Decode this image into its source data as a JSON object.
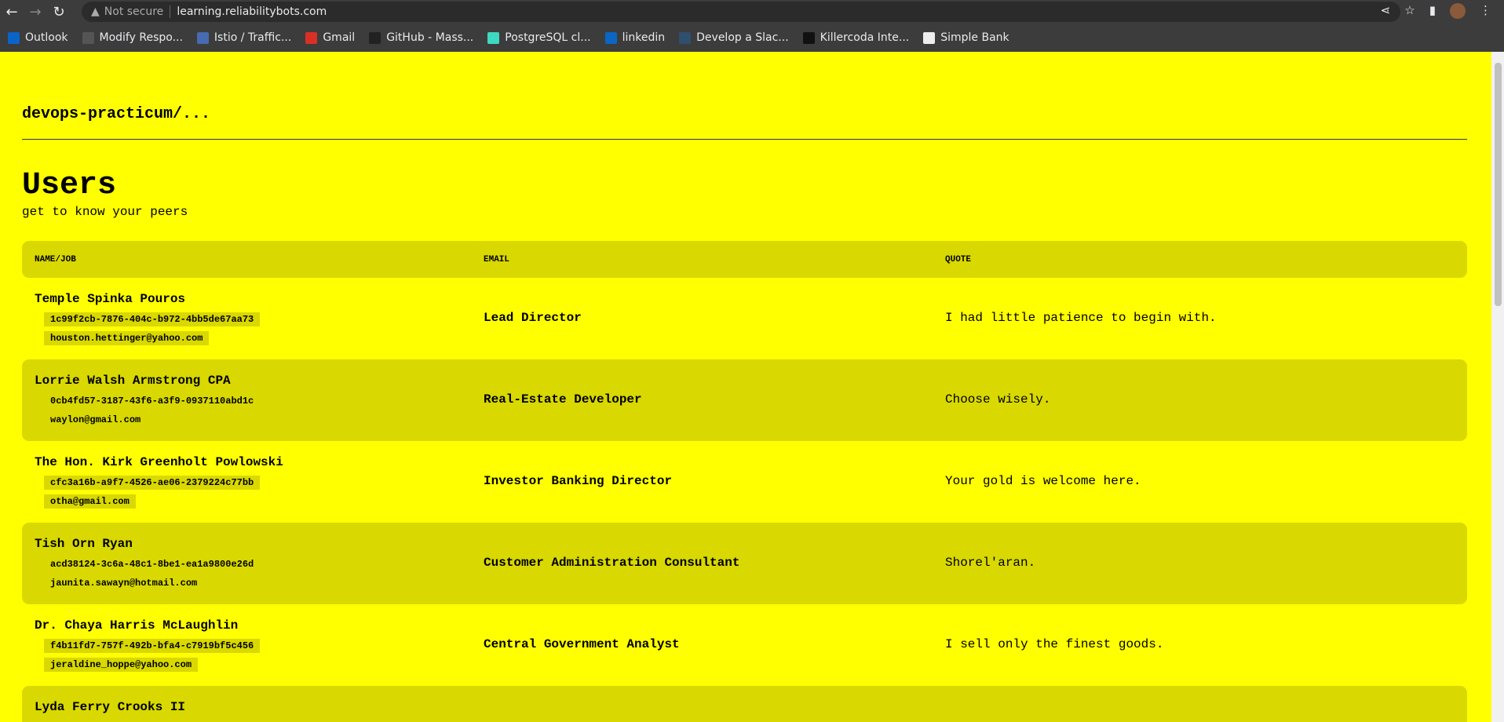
{
  "browser": {
    "security": "Not secure",
    "url": "learning.reliabilitybots.com",
    "bookmarks": [
      {
        "label": "Outlook",
        "color": "#0a64c8"
      },
      {
        "label": "Modify Respo...",
        "color": "#555"
      },
      {
        "label": "Istio / Traffic...",
        "color": "#466bb0"
      },
      {
        "label": "Gmail",
        "color": "#d93025"
      },
      {
        "label": "GitHub - Mass...",
        "color": "#222"
      },
      {
        "label": "PostgreSQL cl...",
        "color": "#3fd8c0"
      },
      {
        "label": "linkedin",
        "color": "#0a66c2"
      },
      {
        "label": "Develop a Slac...",
        "color": "#2f4f6f"
      },
      {
        "label": "Killercoda Inte...",
        "color": "#111"
      },
      {
        "label": "Simple Bank",
        "color": "#eee"
      }
    ]
  },
  "page": {
    "breadcrumb": "devops-practicum/...",
    "title": "Users",
    "subtitle": "get to know your peers"
  },
  "table": {
    "headers": [
      "NAME/JOB",
      "EMAIL",
      "QUOTE"
    ],
    "rows": [
      {
        "name": "Temple Spinka Pouros",
        "id": "1c99f2cb-7876-404c-b972-4bb5de67aa73",
        "email": "houston.hettinger@yahoo.com",
        "job": "Lead Director",
        "quote": "I had little patience to begin with."
      },
      {
        "name": "Lorrie Walsh Armstrong CPA",
        "id": "0cb4fd57-3187-43f6-a3f9-0937110abd1c",
        "email": "waylon@gmail.com",
        "job": "Real-Estate Developer",
        "quote": "Choose wisely."
      },
      {
        "name": "The Hon. Kirk Greenholt Powlowski",
        "id": "cfc3a16b-a9f7-4526-ae06-2379224c77bb",
        "email": "otha@gmail.com",
        "job": "Investor Banking Director",
        "quote": "Your gold is welcome here."
      },
      {
        "name": "Tish Orn Ryan",
        "id": "acd38124-3c6a-48c1-8be1-ea1a9800e26d",
        "email": "jaunita.sawayn@hotmail.com",
        "job": "Customer Administration Consultant",
        "quote": "Shorel'aran."
      },
      {
        "name": "Dr. Chaya Harris McLaughlin",
        "id": "f4b11fd7-757f-492b-bfa4-c7919bf5c456",
        "email": "jeraldine_hoppe@yahoo.com",
        "job": "Central Government Analyst",
        "quote": "I sell only the finest goods."
      },
      {
        "name": "Lyda Ferry Crooks II"
      }
    ]
  },
  "colors": {
    "background": "#ffff00",
    "row_alt": "#d9d800"
  }
}
